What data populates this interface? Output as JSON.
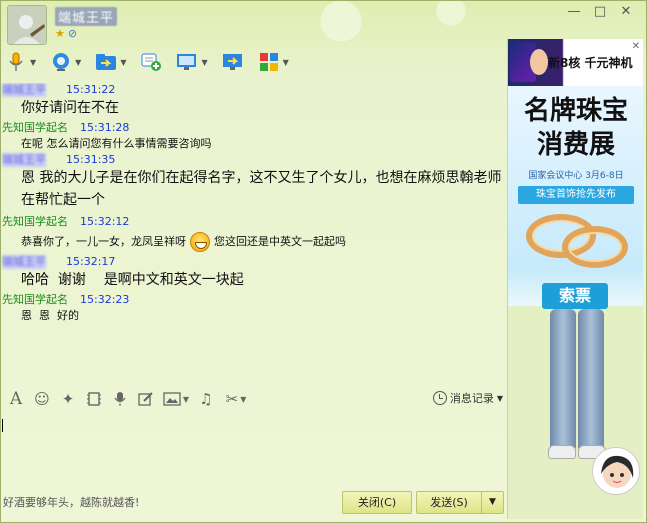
{
  "window": {
    "contact_name": "端城王平",
    "controls": [
      "—",
      "□",
      "✕"
    ]
  },
  "toolbar": {
    "buttons": [
      "microphone-icon",
      "camera-icon",
      "file-transfer-icon",
      "add-contact-icon",
      "screen-share-icon",
      "remote-assist-icon",
      "apps-icon"
    ]
  },
  "chat": {
    "messages": [
      {
        "sender": "端城王平",
        "time": "15:31:22",
        "text": "你好请问在不在",
        "big": true,
        "self": false
      },
      {
        "sender": "先知国学起名",
        "time": "15:31:28",
        "text": "在呢 怎么请问您有什么事情需要咨询吗",
        "big": false,
        "self": true
      },
      {
        "sender": "端城王平",
        "time": "15:31:35",
        "text": "恩  我的大儿子是在你们在起得名字，这不又生了个女儿，也想在麻烦思翰老师在帮忙起一个",
        "big": true,
        "self": false
      },
      {
        "sender": "先知国学起名",
        "time": "15:32:12",
        "text": "恭喜你了，一儿一女，龙凤呈祥呀",
        "text_after": "您这回还是中英文一起起吗",
        "big": false,
        "self": true,
        "emoji": true
      },
      {
        "sender": "端城王平",
        "time": "15:32:17",
        "text": "哈哈  谢谢    是啊中文和英文一块起",
        "big": true,
        "self": false
      },
      {
        "sender": "先知国学起名",
        "time": "15:32:23",
        "text": "恩  恩  好的",
        "big": false,
        "self": true
      }
    ]
  },
  "input_toolbar": {
    "history_label": "消息记录"
  },
  "bottom": {
    "slogan": "好酒要够年头，越陈就越香!",
    "close_label": "关闭(C)",
    "send_label": "发送(S)"
  },
  "ad": {
    "top_text": "新8核 千元神机",
    "headline_1": "名牌珠宝",
    "headline_2": "消费展",
    "subtitle": "国家会议中心  3月6-8日",
    "ribbon": "珠宝首饰抢先发布",
    "button": "索票"
  },
  "colors": {
    "self_name": "#1a8d1a",
    "time": "#1a3ad8",
    "accent": "#1da0d8",
    "background": "#eaf3cf"
  }
}
